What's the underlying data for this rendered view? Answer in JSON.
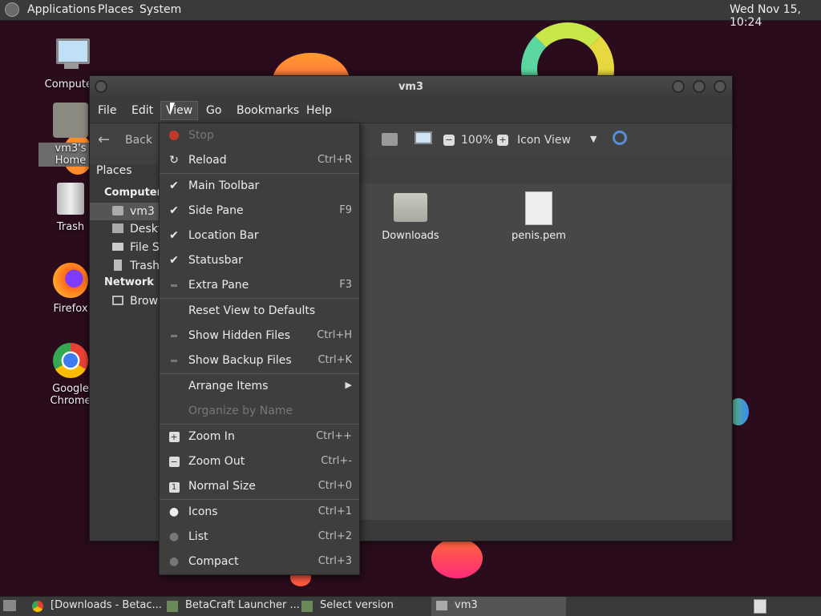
{
  "top_panel": {
    "menus": [
      "Applications",
      "Places",
      "System"
    ],
    "clock": "Wed Nov 15, 10:24"
  },
  "desktop": {
    "icons": [
      {
        "label": "Computer",
        "icon": "computer-icon"
      },
      {
        "label": "vm3's Home",
        "icon": "home-folder-icon"
      },
      {
        "label": "Trash",
        "icon": "trash-icon"
      },
      {
        "label": "Firefox",
        "icon": "firefox-icon"
      },
      {
        "label": "Google Chrome",
        "icon": "chrome-icon"
      }
    ]
  },
  "window": {
    "title": "vm3",
    "menubar": [
      "File",
      "Edit",
      "View",
      "Go",
      "Bookmarks",
      "Help"
    ],
    "toolbar": {
      "back_label": "Back",
      "zoom": "100%",
      "view_mode": "Icon View"
    },
    "sidepane": {
      "header": "Places",
      "section_computer": "Computer",
      "computer_items": [
        "vm3",
        "Desktop",
        "File System",
        "Trash"
      ],
      "section_network": "Network",
      "network_items": [
        "Browse Network"
      ]
    },
    "files": [
      {
        "name": "Downloads",
        "icon": "folder-icon"
      },
      {
        "name": "penis.pem",
        "icon": "document-icon"
      }
    ]
  },
  "view_menu": {
    "items": [
      {
        "label": "Stop",
        "accel": "",
        "indicator": "stop-icon",
        "disabled": true
      },
      {
        "label": "Reload",
        "accel": "Ctrl+R",
        "indicator": "reload-icon",
        "disabled": false
      },
      {
        "label": "Main Toolbar",
        "accel": "",
        "indicator": "check",
        "disabled": false
      },
      {
        "label": "Side Pane",
        "accel": "F9",
        "indicator": "check",
        "disabled": false
      },
      {
        "label": "Location Bar",
        "accel": "",
        "indicator": "check",
        "disabled": false
      },
      {
        "label": "Statusbar",
        "accel": "",
        "indicator": "check",
        "disabled": false
      },
      {
        "label": "Extra Pane",
        "accel": "F3",
        "indicator": "unchecked",
        "disabled": false
      },
      {
        "label": "Reset View to Defaults",
        "accel": "",
        "indicator": "",
        "disabled": false
      },
      {
        "label": "Show Hidden Files",
        "accel": "Ctrl+H",
        "indicator": "unchecked",
        "disabled": false
      },
      {
        "label": "Show Backup Files",
        "accel": "Ctrl+K",
        "indicator": "unchecked",
        "disabled": false
      },
      {
        "label": "Arrange Items",
        "accel": "",
        "indicator": "",
        "disabled": false
      },
      {
        "label": "Organize by Name",
        "accel": "",
        "indicator": "",
        "disabled": true
      },
      {
        "label": "Zoom In",
        "accel": "Ctrl++",
        "indicator": "zoom-in-icon",
        "disabled": false
      },
      {
        "label": "Zoom Out",
        "accel": "Ctrl+-",
        "indicator": "zoom-out-icon",
        "disabled": false
      },
      {
        "label": "Normal Size",
        "accel": "Ctrl+0",
        "indicator": "zoom-normal-icon",
        "disabled": false
      },
      {
        "label": "Icons",
        "accel": "Ctrl+1",
        "indicator": "radio-selected",
        "disabled": false
      },
      {
        "label": "List",
        "accel": "Ctrl+2",
        "indicator": "radio",
        "disabled": false
      },
      {
        "label": "Compact",
        "accel": "Ctrl+3",
        "indicator": "radio",
        "disabled": false
      }
    ]
  },
  "taskbar": {
    "tasks": [
      "[Downloads - Betac...",
      "BetaCraft Launcher ...",
      "Select version",
      "vm3"
    ]
  },
  "colors": {
    "desktop_bg": "#2a0c1c",
    "panel": "#3a3a3a",
    "menu_bg": "#3e3e3e"
  }
}
